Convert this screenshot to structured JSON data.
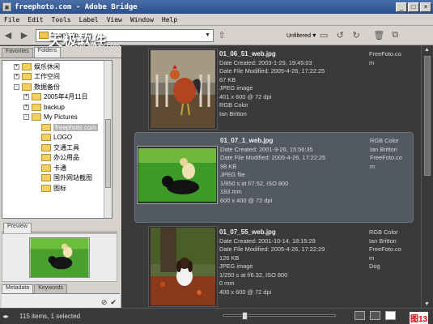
{
  "window": {
    "title": "freephoto.com - Adobe Bridge"
  },
  "menu": [
    "File",
    "Edit",
    "Tools",
    "Label",
    "View",
    "Window",
    "Help"
  ],
  "toolbar": {
    "path": "freephoto.com",
    "filter_label": "Unfiltered",
    "icons": [
      "back-icon",
      "forward-icon",
      "up-folder-icon",
      "new-folder-icon",
      "rotate-left-icon",
      "rotate-right-icon",
      "delete-icon",
      "compact-mode-icon"
    ]
  },
  "watermark": {
    "line1": "天极软件",
    "line2": "Soft.yesky.com"
  },
  "left_panel": {
    "tabs": [
      "Favorites",
      "Folders"
    ],
    "tree": [
      {
        "label": "娱乐休闲",
        "indent": 2,
        "expander": "+"
      },
      {
        "label": "工作空间",
        "indent": 2,
        "expander": "+"
      },
      {
        "label": "数据备份",
        "indent": 2,
        "expander": "-"
      },
      {
        "label": "2005年4月11日",
        "indent": 3,
        "expander": "+"
      },
      {
        "label": "backup",
        "indent": 3,
        "expander": "+"
      },
      {
        "label": "My Pictures",
        "indent": 3,
        "expander": "-"
      },
      {
        "label": "freephoto.com",
        "indent": 4,
        "expander": "",
        "selected": true
      },
      {
        "label": "LOGO",
        "indent": 4,
        "expander": ""
      },
      {
        "label": "交通工具",
        "indent": 4,
        "expander": ""
      },
      {
        "label": "办公用品",
        "indent": 4,
        "expander": ""
      },
      {
        "label": "卡通",
        "indent": 4,
        "expander": ""
      },
      {
        "label": "国外网站截图",
        "indent": 4,
        "expander": ""
      },
      {
        "label": "图标",
        "indent": 4,
        "expander": ""
      }
    ],
    "preview_tab": "Preview",
    "meta_tabs": [
      "Metadata",
      "Keywords"
    ]
  },
  "items": [
    {
      "filename": "01_06_51_web.jpg",
      "lines": [
        "Date Created: 2003-1-29, 19:45:03",
        "Date File Modified: 2005-4-26, 17:22:25",
        "67 KB",
        "JPEG image",
        "401 x 600 @ 72 dpi",
        "RGB Color",
        "Ian Britton"
      ],
      "extra": [
        "FreeFoto.co",
        "m"
      ],
      "selected": false
    },
    {
      "filename": "01_07_1_web.jpg",
      "lines": [
        "Date Created: 2001-9-26, 15:56:35",
        "Date File Modified: 2005-4-26, 17:22:25",
        "98 KB",
        "JPEG file",
        "1/850 s at f/7.52, ISO 800",
        "183 mm",
        "600 x 400 @ 72 dpi"
      ],
      "extra": [
        "RGB Color",
        "Ian Britton",
        "FreeFoto.co",
        "m"
      ],
      "selected": true
    },
    {
      "filename": "01_07_55_web.jpg",
      "lines": [
        "Date Created: 2001-10-14, 18:15:29",
        "Date File Modified: 2005-4-26, 17:22:29",
        "126 KB",
        "JPEG image",
        "1/250 s at f/6.32, ISO 800",
        "0 mm",
        "400 x 600 @ 72 dpi"
      ],
      "extra": [
        "RGB Color",
        "Ian Britton",
        "FreeFoto.co",
        "m",
        "Dog"
      ],
      "selected": false
    }
  ],
  "status": {
    "text": "115 items, 1 selected",
    "slider_fraction": 0.17,
    "corner": "图13"
  }
}
